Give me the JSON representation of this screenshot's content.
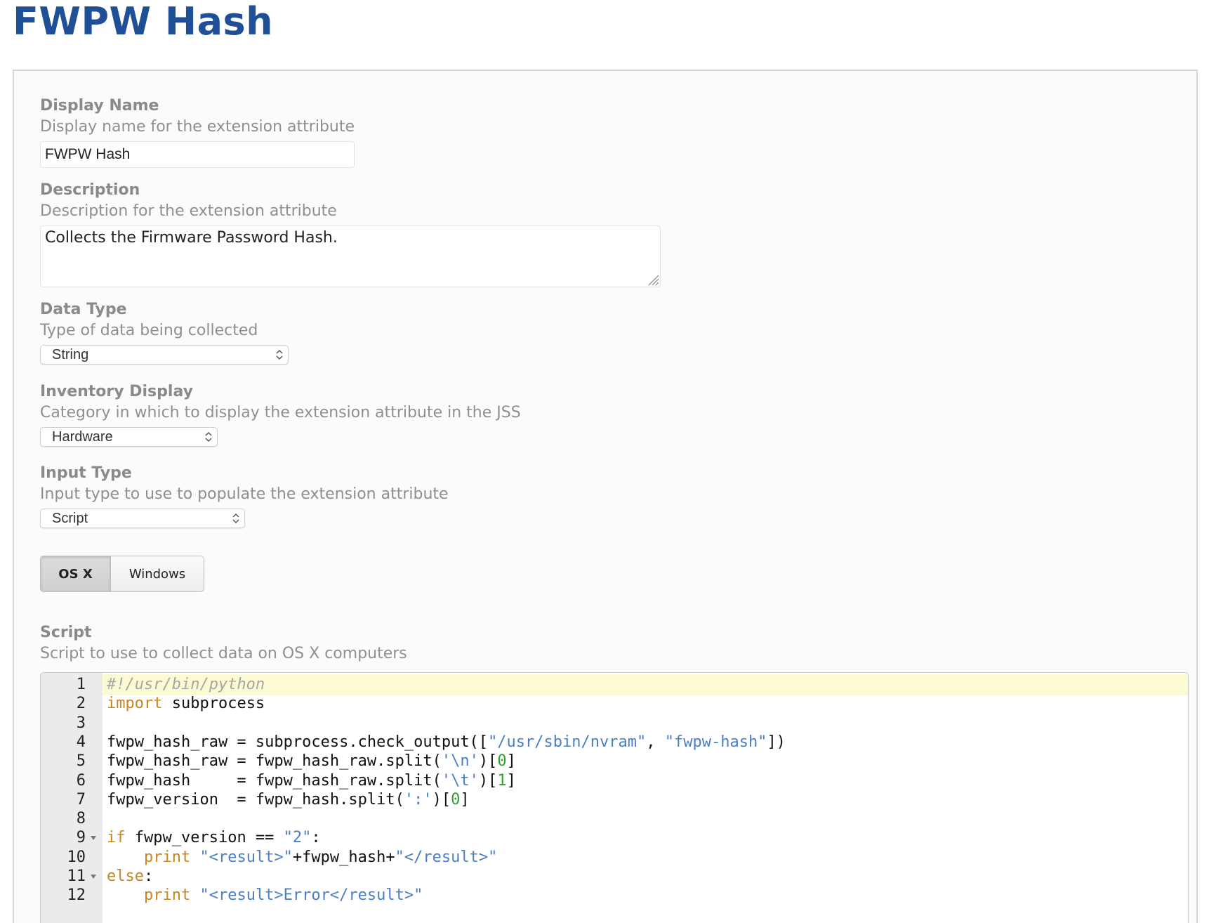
{
  "page": {
    "title": "FWPW Hash"
  },
  "form": {
    "display_name": {
      "label": "Display Name",
      "help": "Display name for the extension attribute",
      "value": "FWPW Hash"
    },
    "description": {
      "label": "Description",
      "help": "Description for the extension attribute",
      "value": "Collects the Firmware Password Hash."
    },
    "data_type": {
      "label": "Data Type",
      "help": "Type of data being collected",
      "selected": "String"
    },
    "inventory_display": {
      "label": "Inventory Display",
      "help": "Category in which to display the extension attribute in the JSS",
      "selected": "Hardware"
    },
    "input_type": {
      "label": "Input Type",
      "help": "Input type to use to populate the extension attribute",
      "selected": "Script"
    },
    "platform_tabs": [
      {
        "label": "OS X",
        "active": true
      },
      {
        "label": "Windows",
        "active": false
      }
    ],
    "script": {
      "label": "Script",
      "help": "Script to use to collect data on OS X computers"
    }
  },
  "editor": {
    "active_line": 1,
    "colors": {
      "comment": "#a6a6a6",
      "keyword": "#c5861f",
      "string": "#4a7fc7",
      "number": "#2ea02e",
      "active_line_bg": "#fcfad2",
      "gutter_bg": "#ebebeb"
    },
    "lines": [
      {
        "n": "1",
        "fold": false,
        "tokens": [
          [
            "comment",
            "#!/usr/bin/python"
          ]
        ]
      },
      {
        "n": "2",
        "fold": false,
        "tokens": [
          [
            "kw",
            "import"
          ],
          [
            "plain",
            " subprocess"
          ]
        ]
      },
      {
        "n": "3",
        "fold": false,
        "tokens": []
      },
      {
        "n": "4",
        "fold": false,
        "tokens": [
          [
            "plain",
            "fwpw_hash_raw = subprocess.check_output(["
          ],
          [
            "str",
            "\"/usr/sbin/nvram\""
          ],
          [
            "plain",
            ", "
          ],
          [
            "str",
            "\"fwpw-hash\""
          ],
          [
            "plain",
            "])"
          ]
        ]
      },
      {
        "n": "5",
        "fold": false,
        "tokens": [
          [
            "plain",
            "fwpw_hash_raw = fwpw_hash_raw.split("
          ],
          [
            "str",
            "'\\n'"
          ],
          [
            "plain",
            ")["
          ],
          [
            "num",
            "0"
          ],
          [
            "plain",
            "]"
          ]
        ]
      },
      {
        "n": "6",
        "fold": false,
        "tokens": [
          [
            "plain",
            "fwpw_hash     = fwpw_hash_raw.split("
          ],
          [
            "str",
            "'\\t'"
          ],
          [
            "plain",
            ")["
          ],
          [
            "num",
            "1"
          ],
          [
            "plain",
            "]"
          ]
        ]
      },
      {
        "n": "7",
        "fold": false,
        "tokens": [
          [
            "plain",
            "fwpw_version  = fwpw_hash.split("
          ],
          [
            "str",
            "':'"
          ],
          [
            "plain",
            ")["
          ],
          [
            "num",
            "0"
          ],
          [
            "plain",
            "]"
          ]
        ]
      },
      {
        "n": "8",
        "fold": false,
        "tokens": []
      },
      {
        "n": "9",
        "fold": true,
        "tokens": [
          [
            "kw",
            "if"
          ],
          [
            "plain",
            " fwpw_version == "
          ],
          [
            "str",
            "\"2\""
          ],
          [
            "plain",
            ":"
          ]
        ]
      },
      {
        "n": "10",
        "fold": false,
        "tokens": [
          [
            "plain",
            "    "
          ],
          [
            "kw",
            "print"
          ],
          [
            "plain",
            " "
          ],
          [
            "str",
            "\"<result>\""
          ],
          [
            "plain",
            "+fwpw_hash+"
          ],
          [
            "str",
            "\"</result>\""
          ]
        ]
      },
      {
        "n": "11",
        "fold": true,
        "tokens": [
          [
            "kw",
            "else"
          ],
          [
            "plain",
            ":"
          ]
        ]
      },
      {
        "n": "12",
        "fold": false,
        "tokens": [
          [
            "plain",
            "    "
          ],
          [
            "kw",
            "print"
          ],
          [
            "plain",
            " "
          ],
          [
            "str",
            "\"<result>Error</result>\""
          ]
        ]
      }
    ]
  }
}
